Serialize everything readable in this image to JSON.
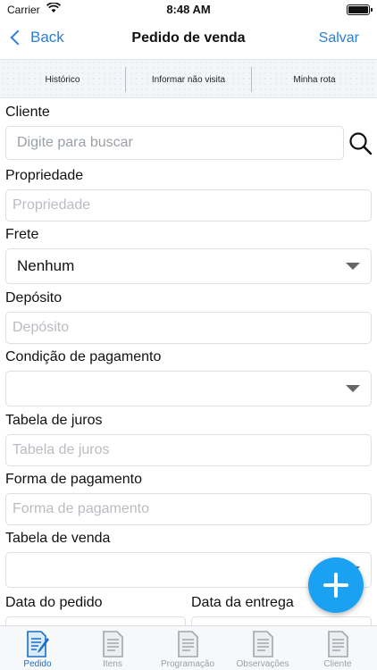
{
  "status_bar": {
    "carrier": "Carrier",
    "time": "8:48 AM"
  },
  "nav": {
    "back_label": "Back",
    "title": "Pedido de venda",
    "save_label": "Salvar"
  },
  "top_tabs": [
    "Histórico",
    "Informar não visita",
    "Minha rota"
  ],
  "form": {
    "cliente": {
      "label": "Cliente",
      "placeholder": "Digite para buscar"
    },
    "propriedade": {
      "label": "Propriedade",
      "placeholder": "Propriedade"
    },
    "frete": {
      "label": "Frete",
      "value": "Nenhum"
    },
    "deposito": {
      "label": "Depósito",
      "placeholder": "Depósito"
    },
    "condicao_pagamento": {
      "label": "Condição de pagamento",
      "value": ""
    },
    "tabela_juros": {
      "label": "Tabela de juros",
      "placeholder": "Tabela de juros"
    },
    "forma_pagamento": {
      "label": "Forma de pagamento",
      "placeholder": "Forma de pagamento"
    },
    "tabela_venda": {
      "label": "Tabela de venda",
      "value": ""
    },
    "data_pedido": {
      "label": "Data do pedido"
    },
    "data_entrega": {
      "label": "Data da entrega"
    }
  },
  "bottom_tabs": [
    "Pedido",
    "Itens",
    "Programação",
    "Observações",
    "Cliente"
  ],
  "active_bottom_tab": "Pedido",
  "colors": {
    "accent": "#2b7fd6",
    "fab": "#1ba1f2",
    "active_tab": "#1a6fc4"
  }
}
